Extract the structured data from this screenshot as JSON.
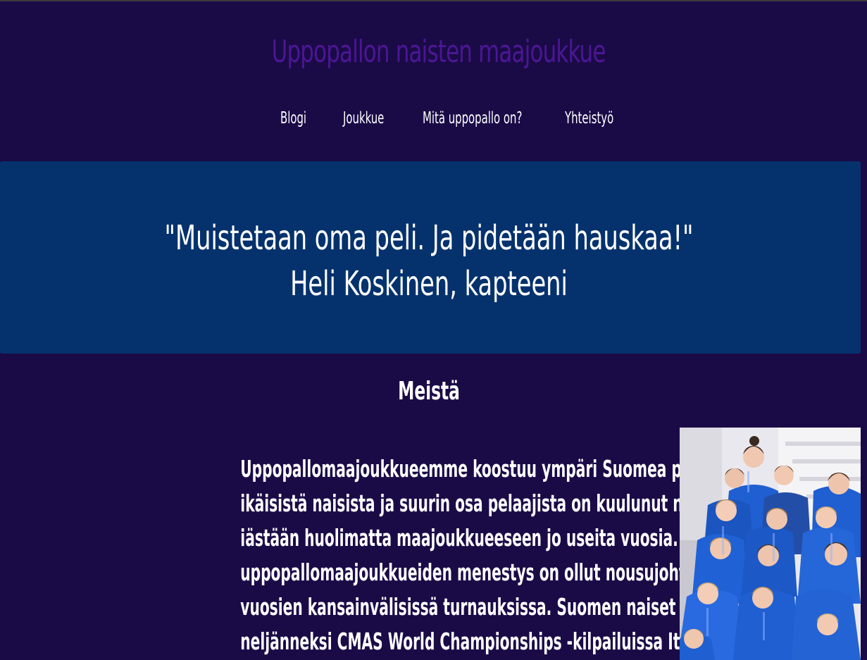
{
  "site": {
    "title": "Uppopallon naisten maajoukkue"
  },
  "nav": {
    "items": [
      {
        "label": "Blogi"
      },
      {
        "label": "Joukkue"
      },
      {
        "label": "Mitä uppopallo on?"
      },
      {
        "label": "Yhteistyö"
      }
    ]
  },
  "hero": {
    "quote": "\"Muistetaan oma peli. Ja pidetään hauskaa!\"",
    "attribution": "Heli Koskinen, kapteeni"
  },
  "about": {
    "heading": "Meistä",
    "lines": [
      "Uppopallomaajoukkueemme koostuu ympäri Suomea pelaavista eri",
      "ikäisistä naisista ja suurin osa pelaajista on kuulunut nuoresta",
      "iästään huolimatta maajoukkueeseen jo useita vuosia. Suomen",
      "uppopallomaajoukkueiden menestys on ollut nousujohteista viime",
      "vuosien kansainvälisissä turnauksissa. Suomen naiset sijoittuivat",
      "neljänneksi CMAS World Championships -kilpailuissa Itävallassa"
    ]
  },
  "colors": {
    "page_background": "#1a0b47",
    "title_purple": "#4c1694",
    "hero_background": "#05326d",
    "jersey_blue": "#1f5fd1",
    "text": "#ffffff"
  }
}
